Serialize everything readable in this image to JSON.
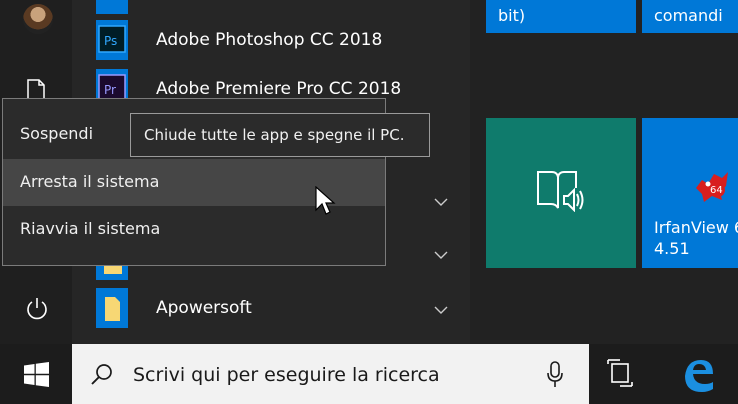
{
  "apps": [
    {
      "name": "Adobe Photoshop CC 2018",
      "icon": "ps-icon",
      "tile_color": "#001d26",
      "accent": "#31a8ff",
      "glyph": "Ps"
    },
    {
      "name": "Adobe Premiere Pro CC 2018",
      "icon": "pr-icon",
      "tile_color": "#1b0a2e",
      "accent": "#9999ff",
      "glyph": "Pr"
    },
    {
      "name": "Apowersoft",
      "icon": "folder-icon",
      "tile_color": "#0078d7"
    }
  ],
  "tiles": [
    {
      "label": "bit)"
    },
    {
      "label": "comandi"
    },
    {
      "label": "IrfanView 6",
      "label2": "4.51",
      "badge": "64"
    }
  ],
  "power_menu": {
    "items": [
      "Sospendi",
      "Arresta il sistema",
      "Riavvia il sistema"
    ],
    "hovered_index": 1
  },
  "tooltip": "Chiude tutte le app e spegne il PC.",
  "taskbar": {
    "search_placeholder": "Scrivi qui per eseguire la ricerca"
  },
  "colors": {
    "tile_blue": "#0078d7",
    "tile_teal": "#0f7b6c",
    "taskbar": "#1c1c1c",
    "search_bg": "#f2f2f2"
  }
}
